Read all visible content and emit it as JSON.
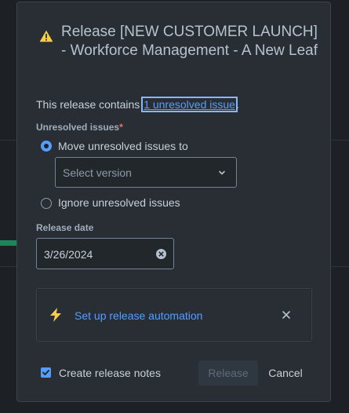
{
  "dialog": {
    "title": "Release [NEW CUSTOMER LAUNCH] - Workforce Management - A New Leaf",
    "description_prefix": "This release contains ",
    "unresolved_link": "1 unresolved issue",
    "description_suffix": ".",
    "unresolved_label": "Unresolved issues",
    "required_mark": "*",
    "option_move": "Move unresolved issues to",
    "option_move_selected": true,
    "version_placeholder": "Select version",
    "option_ignore": "Ignore unresolved issues",
    "release_date_label": "Release date",
    "release_date_value": "3/26/2024",
    "automation_link": "Set up release automation",
    "create_notes_label": "Create release notes",
    "create_notes_checked": true,
    "release_button": "Release",
    "cancel_button": "Cancel"
  },
  "icons": {
    "warning": "warning-icon",
    "chevron": "chevron-down-icon",
    "clear": "clear-icon",
    "automation": "lightning-icon",
    "close": "close-icon",
    "checkbox": "checkmark-icon"
  },
  "colors": {
    "background": "#1d2125",
    "dialog": "#282e33",
    "accent": "#579dff",
    "warning": "#f5cd47",
    "required": "#f87168"
  }
}
